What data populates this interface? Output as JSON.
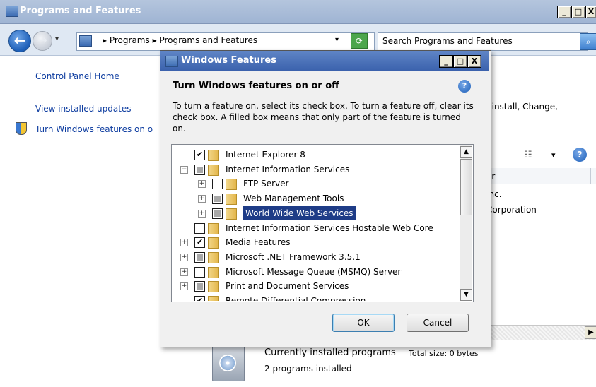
{
  "main_window": {
    "title": "Programs and Features",
    "minimize": "_",
    "maximize": "□",
    "close": "X"
  },
  "addressbar": {
    "crumb_separator": "▸",
    "crumbs": [
      "Programs",
      "Programs and Features"
    ],
    "dropdown": "▾",
    "search_placeholder": "Search Programs and Features"
  },
  "sidebar": {
    "items": [
      {
        "label": "Control Panel Home"
      },
      {
        "label": "View installed updates"
      },
      {
        "label": "Turn Windows features on o"
      }
    ]
  },
  "main": {
    "description_fragment": "ninstall, Change,",
    "column_header": "er",
    "rows": [
      "Inc.",
      "Corporation"
    ],
    "installed_title": "Currently installed programs",
    "installed_size": "Total size: 0 bytes",
    "installed_count": "2 programs installed"
  },
  "dialog": {
    "title": "Windows Features",
    "heading": "Turn Windows features on or off",
    "description": "To turn a feature on, select its check box. To turn a feature off, clear its check box. A filled box means that only part of the feature is turned on.",
    "ok_label": "OK",
    "cancel_label": "Cancel",
    "features": [
      {
        "label": "Internet Explorer 8",
        "indent": 0,
        "expander": "",
        "state": "checked"
      },
      {
        "label": "Internet Information Services",
        "indent": 0,
        "expander": "−",
        "state": "partial"
      },
      {
        "label": "FTP Server",
        "indent": 1,
        "expander": "+",
        "state": "unchecked"
      },
      {
        "label": "Web Management Tools",
        "indent": 1,
        "expander": "+",
        "state": "partial"
      },
      {
        "label": "World Wide Web Services",
        "indent": 1,
        "expander": "+",
        "state": "partial",
        "selected": true
      },
      {
        "label": "Internet Information Services Hostable Web Core",
        "indent": 0,
        "expander": "",
        "state": "unchecked"
      },
      {
        "label": "Media Features",
        "indent": 0,
        "expander": "+",
        "state": "checked"
      },
      {
        "label": "Microsoft .NET Framework 3.5.1",
        "indent": 0,
        "expander": "+",
        "state": "partial"
      },
      {
        "label": "Microsoft Message Queue (MSMQ) Server",
        "indent": 0,
        "expander": "+",
        "state": "unchecked"
      },
      {
        "label": "Print and Document Services",
        "indent": 0,
        "expander": "+",
        "state": "partial"
      },
      {
        "label": "Remote Differential Compression",
        "indent": 0,
        "expander": "",
        "state": "checked"
      }
    ]
  }
}
